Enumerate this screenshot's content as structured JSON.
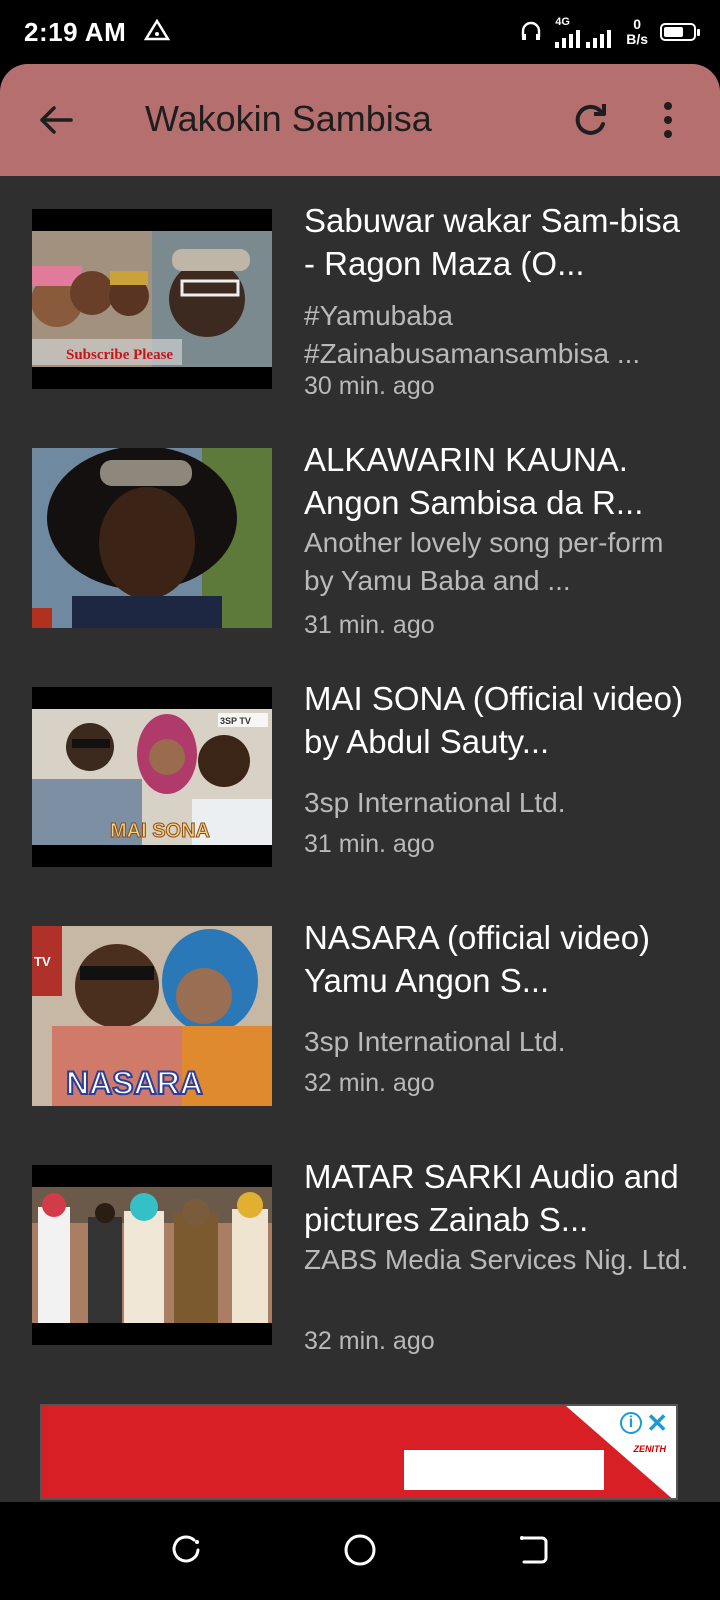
{
  "status_bar": {
    "time": "2:19 AM",
    "network_type": "4G",
    "speed_value": "0",
    "speed_unit": "B/s",
    "icons": [
      "alert-triangle-icon",
      "headphones-icon",
      "signal-icon",
      "battery-icon"
    ]
  },
  "toolbar": {
    "title": "Wakokin Sambisa",
    "back_icon": "arrow-left-icon",
    "refresh_icon": "refresh-icon",
    "menu_icon": "more-vertical-icon",
    "background_color": "#b56f6f"
  },
  "videos": [
    {
      "title": "Sabuwar wakar Sam-bisa - Ragon Maza (O...",
      "description": "#Yamubaba #Zainabusamansambisa ...",
      "time": "30 min. ago",
      "thumb_caption": "Subscribe Please"
    },
    {
      "title": "ALKAWARIN KAUNA. Angon Sambisa da R...",
      "description": "Another lovely song  per-form by Yamu Baba and ...",
      "time": "31 min. ago",
      "thumb_caption": ""
    },
    {
      "title": "MAI SONA (Official video) by Abdul Sauty...",
      "description": "3sp International Ltd.",
      "time": "31 min. ago",
      "thumb_caption": "MAI SONA",
      "thumb_badge": "3SP TV"
    },
    {
      "title": "NASARA (official video) Yamu Angon S...",
      "description": "3sp International Ltd.",
      "time": "32 min. ago",
      "thumb_caption": "NASARA",
      "thumb_badge": "TV"
    },
    {
      "title": "MATAR SARKI  Audio and pictures Zainab S...",
      "description": "ZABS Media Services Nig. Ltd.",
      "time": "32 min. ago",
      "thumb_caption": ""
    }
  ],
  "ad": {
    "brand": "ZENITH",
    "info_icon": "info-icon",
    "close_icon": "close-icon",
    "info_glyph": "i",
    "close_glyph": "✕"
  },
  "nav_bar": {
    "icons": [
      "recents-icon",
      "home-icon",
      "back-icon"
    ]
  }
}
